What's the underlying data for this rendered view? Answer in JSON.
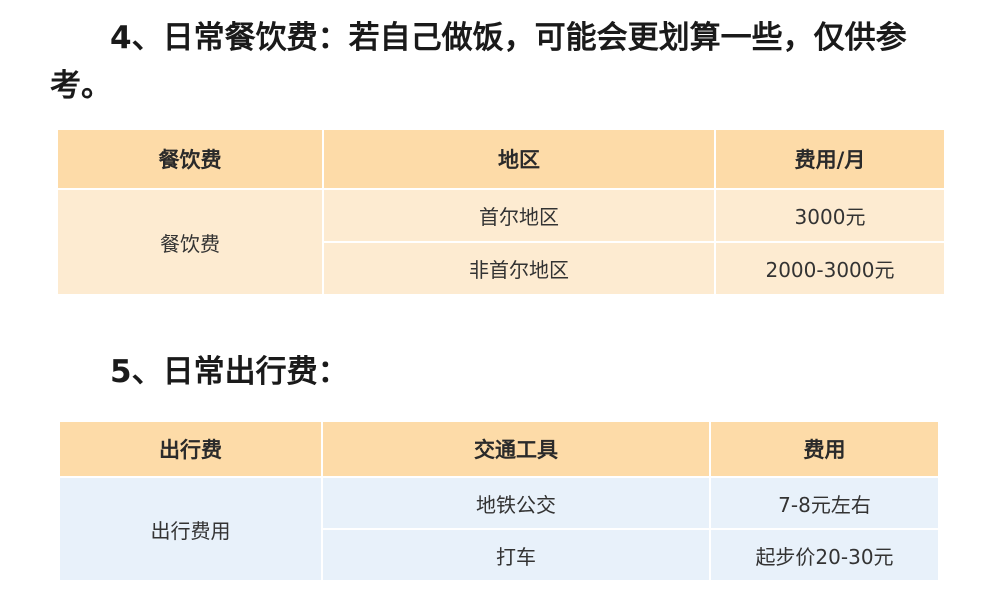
{
  "sections": {
    "food": {
      "heading": "4、日常餐饮费：若自己做饭，可能会更划算一些，仅供参考。",
      "table": {
        "headers": [
          "餐饮费",
          "地区",
          "费用/月"
        ],
        "category": "餐饮费",
        "rows": [
          {
            "region": "首尔地区",
            "cost": "3000元"
          },
          {
            "region": "非首尔地区",
            "cost": "2000-3000元"
          }
        ]
      }
    },
    "travel": {
      "heading": "5、日常出行费：",
      "table": {
        "headers": [
          "出行费",
          "交通工具",
          "费用"
        ],
        "category": "出行费用",
        "rows": [
          {
            "transport": "地铁公交",
            "cost": "7-8元左右"
          },
          {
            "transport": "打车",
            "cost": "起步价20-30元"
          }
        ]
      }
    }
  },
  "colors": {
    "food_header_bg": "#fddba8",
    "food_cell_bg": "#fdebd1",
    "travel_header_bg": "#fddba8",
    "travel_cell_bg": "#e8f1fa"
  }
}
